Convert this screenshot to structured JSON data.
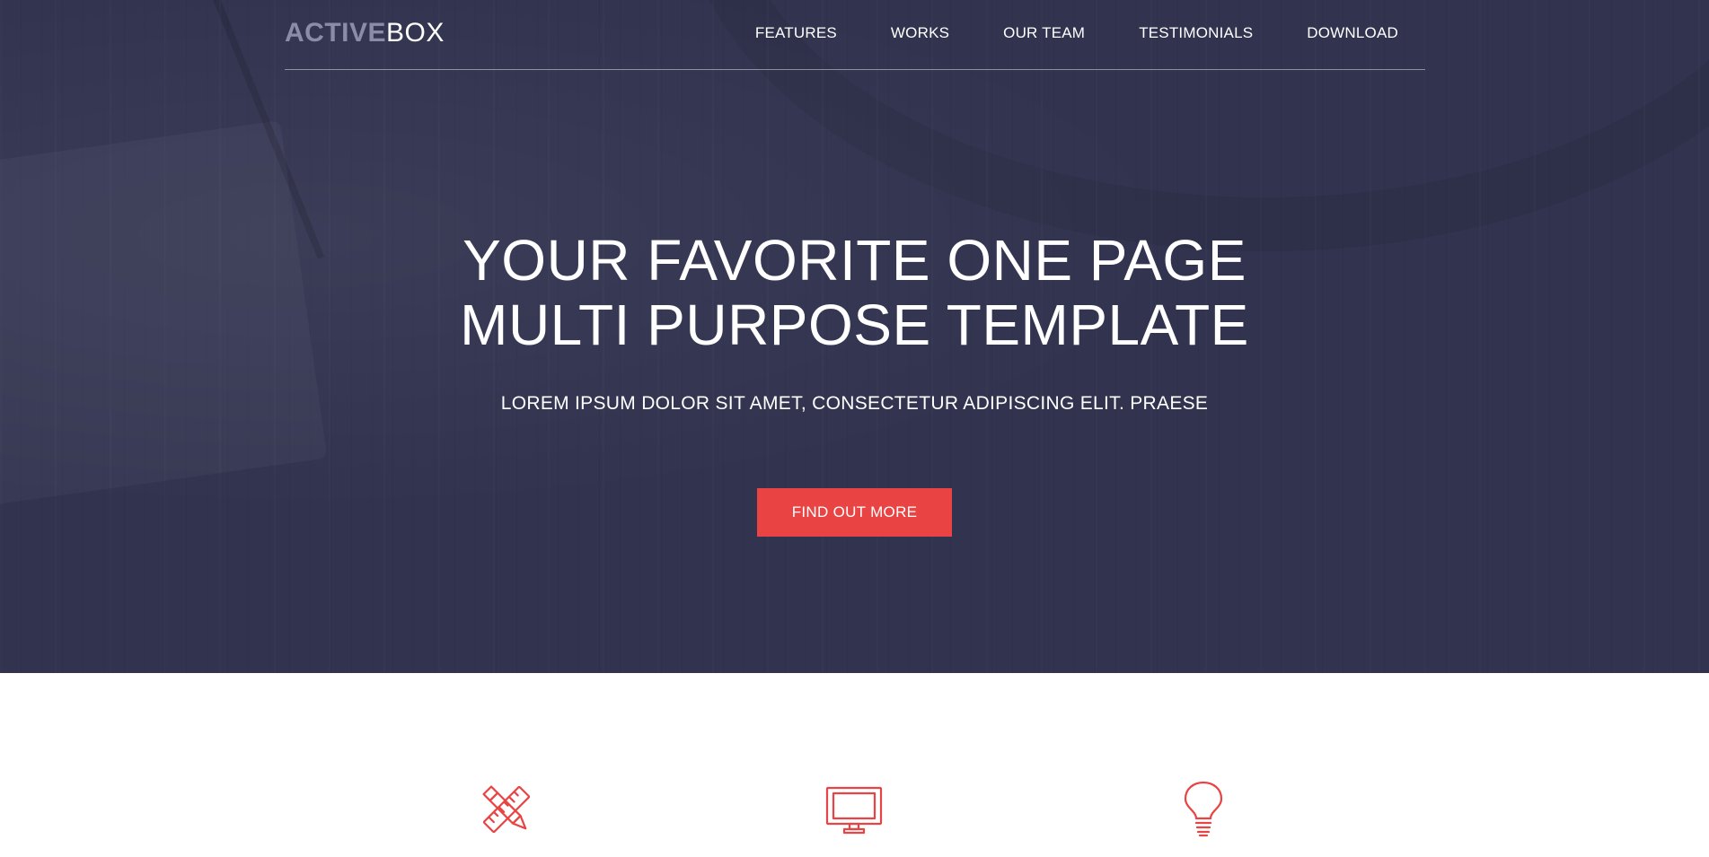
{
  "brand": {
    "bold": "ACTIVE",
    "light": "BOX"
  },
  "nav": {
    "items": [
      "FEATURES",
      "WORKS",
      "OUR TEAM",
      "TESTIMONIALS",
      "DOWNLOAD"
    ]
  },
  "hero": {
    "title_line1": "YOUR FAVORITE ONE PAGE",
    "title_line2": "MULTI PURPOSE TEMPLATE",
    "subtitle": "LOREM IPSUM DOLOR SIT AMET, CONSECTETUR ADIPISCING ELIT. PRAESE",
    "cta_label": "FIND OUT MORE"
  },
  "features": {
    "icons": [
      "pencil-ruler-icon",
      "monitor-icon",
      "lightbulb-icon"
    ]
  },
  "colors": {
    "hero_bg": "#31334f",
    "accent": "#e94343",
    "logo_muted": "#8b8da7",
    "text_light": "#ffffff"
  }
}
